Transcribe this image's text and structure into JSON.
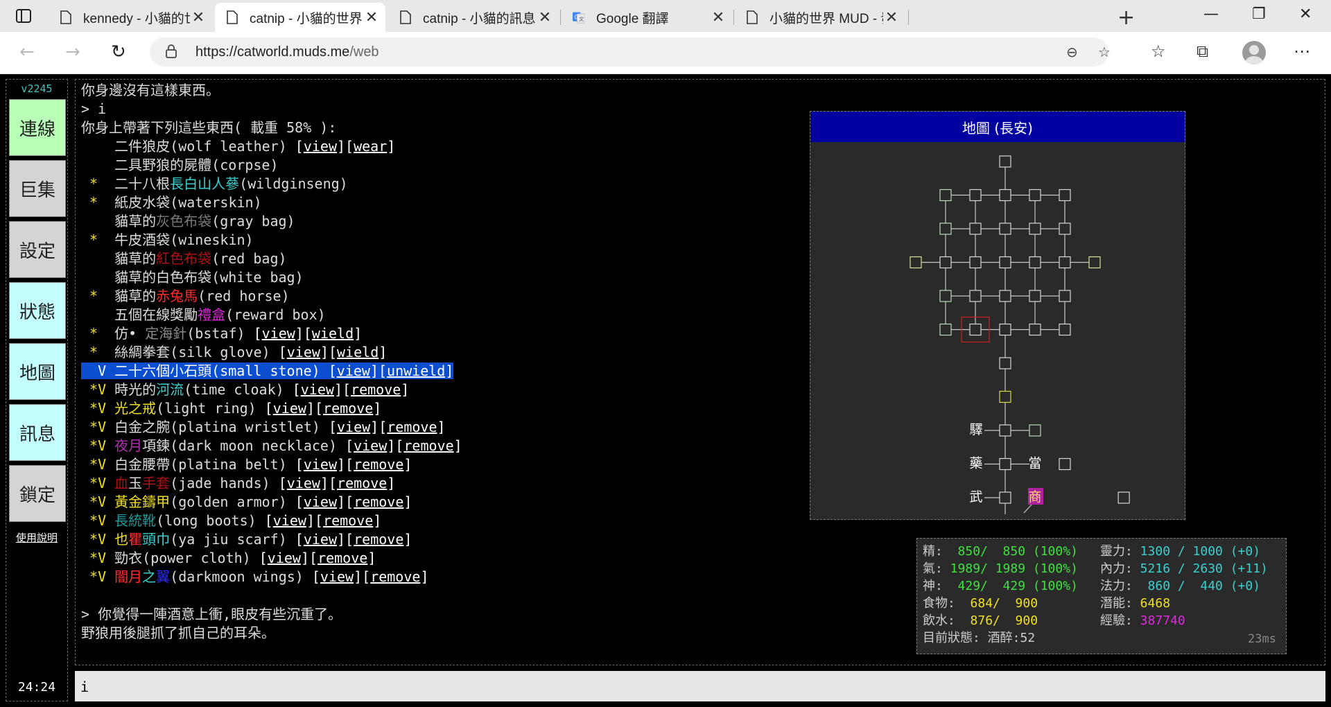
{
  "browser": {
    "tabs": [
      {
        "title": "kennedy - 小貓的世界 WEB"
      },
      {
        "title": "catnip - 小貓的世界 WEB"
      },
      {
        "title": "catnip - 小貓的訊息"
      },
      {
        "title": "Google 翻譯"
      },
      {
        "title": "小貓的世界 MUD - 發表新"
      }
    ],
    "url_main": "https://catworld.muds.me",
    "url_path": "/web"
  },
  "sidebar": {
    "version": "v2245",
    "buttons": [
      {
        "label": "連線",
        "color": "#b8ffb8"
      },
      {
        "label": "巨集",
        "color": "#d4d4d4"
      },
      {
        "label": "設定",
        "color": "#d4d4d4"
      },
      {
        "label": "狀態",
        "color": "#c4ffff"
      },
      {
        "label": "地圖",
        "color": "#c4ffff"
      },
      {
        "label": "訊息",
        "color": "#c4ffff"
      },
      {
        "label": "鎖定",
        "color": "#d4d4d4"
      }
    ],
    "help": "使用說明",
    "clock": "24:24"
  },
  "terminal": {
    "lines": [
      [
        {
          "t": "你身邊沒有這樣東西。"
        }
      ],
      [
        {
          "t": "> i"
        }
      ],
      [
        {
          "t": "你身上帶著下列這些東西( 載重 58% ):"
        }
      ],
      [
        {
          "t": "    二件狼皮(wolf leather) "
        },
        {
          "t": "[",
          "c": "#fff"
        },
        {
          "t": "view",
          "link": true
        },
        {
          "t": "][",
          "c": "#fff"
        },
        {
          "t": "wear",
          "link": true
        },
        {
          "t": "]",
          "c": "#fff"
        }
      ],
      [
        {
          "t": "    二具野狼的屍體(corpse)"
        }
      ],
      [
        {
          "t": " *  ",
          "c": "#f0e020"
        },
        {
          "t": "二十八根"
        },
        {
          "t": "長白山人蔘",
          "c": "#3ad0d0"
        },
        {
          "t": "(wildginseng)"
        }
      ],
      [
        {
          "t": " *  ",
          "c": "#f0e020"
        },
        {
          "t": "紙皮水袋(waterskin)"
        }
      ],
      [
        {
          "t": "    貓草的"
        },
        {
          "t": "灰色布袋",
          "c": "#7a7a7a"
        },
        {
          "t": "(gray bag)"
        }
      ],
      [
        {
          "t": " *  ",
          "c": "#f0e020"
        },
        {
          "t": "牛皮酒袋(wineskin)"
        }
      ],
      [
        {
          "t": "    貓草的"
        },
        {
          "t": "紅色布袋",
          "c": "#b01010"
        },
        {
          "t": "(red bag)"
        }
      ],
      [
        {
          "t": "    貓草的白色布袋(white bag)"
        }
      ],
      [
        {
          "t": " *  ",
          "c": "#f0e020"
        },
        {
          "t": "貓草的"
        },
        {
          "t": "赤兔馬",
          "c": "#ff2a2a"
        },
        {
          "t": "(red horse)"
        }
      ],
      [
        {
          "t": "    五個在線獎勵"
        },
        {
          "t": "禮盒",
          "c": "#e028e0"
        },
        {
          "t": "(reward box)"
        }
      ],
      [
        {
          "t": " *  ",
          "c": "#f0e020"
        },
        {
          "t": "仿• "
        },
        {
          "t": "定海針",
          "c": "#8a8a8a"
        },
        {
          "t": "(bstaf) "
        },
        {
          "t": "[",
          "c": "#fff"
        },
        {
          "t": "view",
          "link": true
        },
        {
          "t": "][",
          "c": "#fff"
        },
        {
          "t": "wield",
          "link": true
        },
        {
          "t": "]",
          "c": "#fff"
        }
      ],
      [
        {
          "t": " *  ",
          "c": "#f0e020"
        },
        {
          "t": "絲綢拳套(silk glove) "
        },
        {
          "t": "[",
          "c": "#fff"
        },
        {
          "t": "view",
          "link": true
        },
        {
          "t": "][",
          "c": "#fff"
        },
        {
          "t": "wield",
          "link": true
        },
        {
          "t": "]",
          "c": "#fff"
        }
      ],
      [
        {
          "t": "  V 二十六個小石頭(small stone) [",
          "hl": true
        },
        {
          "t": "view",
          "hl": true,
          "link": true
        },
        {
          "t": "][",
          "hl": true
        },
        {
          "t": "unwield",
          "hl": true,
          "link": true
        },
        {
          "t": "]",
          "hl": true
        }
      ],
      [
        {
          "t": " *V ",
          "c": "#f0e020"
        },
        {
          "t": "時光的"
        },
        {
          "t": "河流",
          "c": "#3ad0d0"
        },
        {
          "t": "(time cloak) "
        },
        {
          "t": "[",
          "c": "#fff"
        },
        {
          "t": "view",
          "link": true
        },
        {
          "t": "][",
          "c": "#fff"
        },
        {
          "t": "remove",
          "link": true
        },
        {
          "t": "]",
          "c": "#fff"
        }
      ],
      [
        {
          "t": " *V ",
          "c": "#f0e020"
        },
        {
          "t": "光之戒",
          "c": "#f0e020"
        },
        {
          "t": "(light ring) "
        },
        {
          "t": "[",
          "c": "#fff"
        },
        {
          "t": "view",
          "link": true
        },
        {
          "t": "][",
          "c": "#fff"
        },
        {
          "t": "remove",
          "link": true
        },
        {
          "t": "]",
          "c": "#fff"
        }
      ],
      [
        {
          "t": " *V ",
          "c": "#f0e020"
        },
        {
          "t": "白金之腕(platina wristlet) "
        },
        {
          "t": "[",
          "c": "#fff"
        },
        {
          "t": "view",
          "link": true
        },
        {
          "t": "][",
          "c": "#fff"
        },
        {
          "t": "remove",
          "link": true
        },
        {
          "t": "]",
          "c": "#fff"
        }
      ],
      [
        {
          "t": " *V ",
          "c": "#f0e020"
        },
        {
          "t": "夜月",
          "c": "#b030b0"
        },
        {
          "t": "項鍊(dark moon necklace) "
        },
        {
          "t": "[",
          "c": "#fff"
        },
        {
          "t": "view",
          "link": true
        },
        {
          "t": "][",
          "c": "#fff"
        },
        {
          "t": "remove",
          "link": true
        },
        {
          "t": "]",
          "c": "#fff"
        }
      ],
      [
        {
          "t": " *V ",
          "c": "#f0e020"
        },
        {
          "t": "白金腰帶(platina belt) "
        },
        {
          "t": "[",
          "c": "#fff"
        },
        {
          "t": "view",
          "link": true
        },
        {
          "t": "][",
          "c": "#fff"
        },
        {
          "t": "remove",
          "link": true
        },
        {
          "t": "]",
          "c": "#fff"
        }
      ],
      [
        {
          "t": " *V ",
          "c": "#f0e020"
        },
        {
          "t": "血",
          "c": "#b01010"
        },
        {
          "t": "玉"
        },
        {
          "t": "手套",
          "c": "#b01010"
        },
        {
          "t": "(jade hands) "
        },
        {
          "t": "[",
          "c": "#fff"
        },
        {
          "t": "view",
          "link": true
        },
        {
          "t": "][",
          "c": "#fff"
        },
        {
          "t": "remove",
          "link": true
        },
        {
          "t": "]",
          "c": "#fff"
        }
      ],
      [
        {
          "t": " *V ",
          "c": "#f0e020"
        },
        {
          "t": "黃金鑄甲",
          "c": "#f0e020"
        },
        {
          "t": "(golden armor) "
        },
        {
          "t": "[",
          "c": "#fff"
        },
        {
          "t": "view",
          "link": true
        },
        {
          "t": "][",
          "c": "#fff"
        },
        {
          "t": "remove",
          "link": true
        },
        {
          "t": "]",
          "c": "#fff"
        }
      ],
      [
        {
          "t": " *V ",
          "c": "#f0e020"
        },
        {
          "t": "長統靴",
          "c": "#1a9a9a"
        },
        {
          "t": "(long boots) "
        },
        {
          "t": "[",
          "c": "#fff"
        },
        {
          "t": "view",
          "link": true
        },
        {
          "t": "][",
          "c": "#fff"
        },
        {
          "t": "remove",
          "link": true
        },
        {
          "t": "]",
          "c": "#fff"
        }
      ],
      [
        {
          "t": " *V ",
          "c": "#f0e020"
        },
        {
          "t": "也",
          "c": "#f0e020"
        },
        {
          "t": "瞿",
          "c": "#ff2a2a"
        },
        {
          "t": "頭巾",
          "c": "#3ad0d0"
        },
        {
          "t": "(ya jiu scarf) "
        },
        {
          "t": "[",
          "c": "#fff"
        },
        {
          "t": "view",
          "link": true
        },
        {
          "t": "][",
          "c": "#fff"
        },
        {
          "t": "remove",
          "link": true
        },
        {
          "t": "]",
          "c": "#fff"
        }
      ],
      [
        {
          "t": " *V ",
          "c": "#f0e020"
        },
        {
          "t": "勁衣(power cloth) "
        },
        {
          "t": "[",
          "c": "#fff"
        },
        {
          "t": "view",
          "link": true
        },
        {
          "t": "][",
          "c": "#fff"
        },
        {
          "t": "remove",
          "link": true
        },
        {
          "t": "]",
          "c": "#fff"
        }
      ],
      [
        {
          "t": " *V ",
          "c": "#f0e020"
        },
        {
          "t": "闇月",
          "c": "#ff2a2a"
        },
        {
          "t": "之",
          "c": "#3ad0d0"
        },
        {
          "t": "翼",
          "c": "#2a2aff"
        },
        {
          "t": "(darkmoon wings) "
        },
        {
          "t": "[",
          "c": "#fff"
        },
        {
          "t": "view",
          "link": true
        },
        {
          "t": "][",
          "c": "#fff"
        },
        {
          "t": "remove",
          "link": true
        },
        {
          "t": "]",
          "c": "#fff"
        }
      ],
      [
        {
          "t": " "
        }
      ],
      [
        {
          "t": "> 你覺得一陣酒意上衝,眼皮有些沉重了。"
        }
      ],
      [
        {
          "t": "野狼用後腿抓了抓自己的耳朵。"
        }
      ]
    ]
  },
  "map": {
    "title": "地圖 (長安)",
    "labels": {
      "post": "驛",
      "herb": "藥",
      "pawn": "當",
      "martial": "武",
      "shop": "商"
    }
  },
  "stats": {
    "left": [
      {
        "label": "精:",
        "value": "  850/  850 (100%)",
        "color": "#40e040"
      },
      {
        "label": "氣:",
        "value": " 1989/ 1989 (100%)",
        "color": "#40e040"
      },
      {
        "label": "神:",
        "value": "  429/  429 (100%)",
        "color": "#40e040"
      },
      {
        "label": "食物:",
        "value": "  684/  900",
        "color": "#f0e020"
      },
      {
        "label": "飲水:",
        "value": "  876/  900",
        "color": "#f0e020"
      }
    ],
    "right": [
      {
        "label": "靈力:",
        "value": " 1300 / 1000 (+0)",
        "color": "#3ad0d0"
      },
      {
        "label": "內力:",
        "value": " 5216 / 2630 (+11)",
        "color": "#3ad0d0"
      },
      {
        "label": "法力:",
        "value": "  860 /  440 (+0)",
        "color": "#3ad0d0"
      },
      {
        "label": "潛能:",
        "value": " 6468",
        "color": "#f0e020"
      },
      {
        "label": "經驗:",
        "value": " 387740",
        "color": "#e028e0"
      }
    ],
    "status": "目前狀態: 酒醉:52",
    "latency": "23ms"
  },
  "command": {
    "value": "i"
  }
}
